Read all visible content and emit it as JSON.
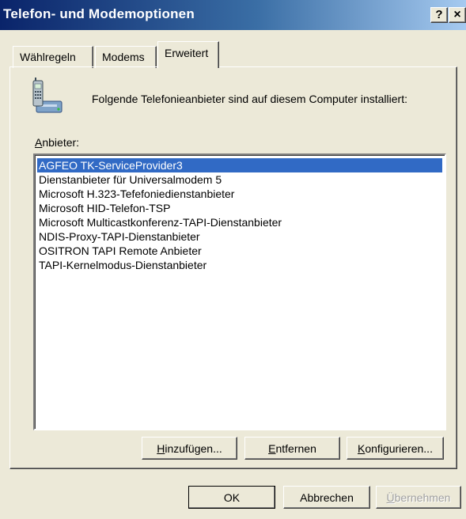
{
  "window": {
    "title": "Telefon- und Modemoptionen",
    "help_button": "?",
    "close_button": "×"
  },
  "tabs": [
    {
      "label": "Wählregeln",
      "selected": false
    },
    {
      "label": "Modems",
      "selected": false
    },
    {
      "label": "Erweitert",
      "selected": true
    }
  ],
  "content": {
    "icon": "telephone-modem-icon",
    "info_text": "Folgende Telefonieanbieter sind auf diesem Computer installiert:",
    "list_label_mnemonic": "A",
    "list_label_rest": "nbieter:",
    "providers": [
      "AGFEO TK-ServiceProvider3",
      "Dienstanbieter für Universalmodem 5",
      "Microsoft H.323-Tefefoniedienstanbieter",
      "Microsoft HID-Telefon-TSP",
      "Microsoft Multicastkonferenz-TAPI-Dienstanbieter",
      "NDIS-Proxy-TAPI-Dienstanbieter",
      "OSITRON TAPI Remote Anbieter",
      "TAPI-Kernelmodus-Dienstanbieter"
    ],
    "selected_provider": "AGFEO TK-ServiceProvider3"
  },
  "provider_buttons": {
    "add_mnemonic": "H",
    "add_rest": "inzufügen...",
    "remove_mnemonic": "E",
    "remove_rest": "ntfernen",
    "configure_mnemonic": "K",
    "configure_rest": "onfigurieren..."
  },
  "dialog_buttons": {
    "ok": "OK",
    "cancel": "Abbrechen",
    "apply_mnemonic": "Ü",
    "apply_rest": "bernehmen"
  },
  "colors": {
    "titlebar_start": "#0a246a",
    "titlebar_end": "#a6caf0",
    "selection": "#316ac5",
    "face": "#ece9d8"
  }
}
